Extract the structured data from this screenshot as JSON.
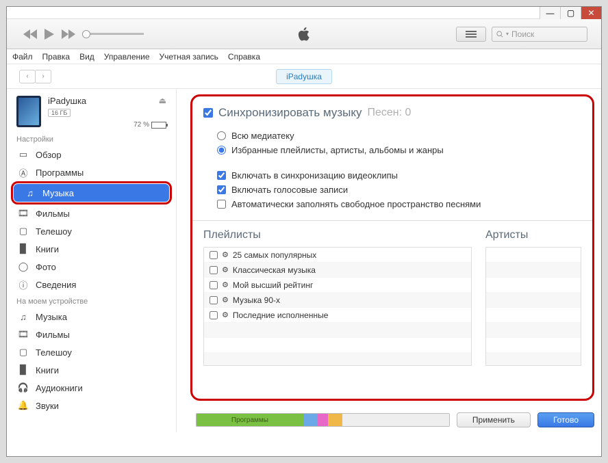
{
  "titlebar": {
    "min": "—",
    "max": "▢",
    "close": "✕"
  },
  "search": {
    "placeholder": "Поиск"
  },
  "menu": {
    "file": "Файл",
    "edit": "Правка",
    "view": "Вид",
    "controls": "Управление",
    "account": "Учетная запись",
    "help": "Справка"
  },
  "device": {
    "pill": "iPadушка",
    "name": "iPadушка",
    "capacity": "16 ГБ",
    "battery": "72 %"
  },
  "sections": {
    "settings": "Настройки",
    "ondevice": "На моем устройстве"
  },
  "settings_items": {
    "overview": "Обзор",
    "apps": "Программы",
    "music": "Музыка",
    "movies": "Фильмы",
    "tv": "Телешоу",
    "books": "Книги",
    "photos": "Фото",
    "info": "Сведения"
  },
  "device_items": {
    "music": "Музыка",
    "movies": "Фильмы",
    "tv": "Телешоу",
    "books": "Книги",
    "audiobooks": "Аудиокниги",
    "sounds": "Звуки"
  },
  "sync": {
    "title": "Синхронизировать музыку",
    "songs": "Песен: 0",
    "all": "Всю медиатеку",
    "selected": "Избранные плейлисты, артисты, альбомы и жанры",
    "videos": "Включать в синхронизацию видеоклипы",
    "voice": "Включать голосовые записи",
    "autofill": "Автоматически заполнять свободное пространство песнями"
  },
  "columns": {
    "playlists": "Плейлисты",
    "artists": "Артисты"
  },
  "playlists": [
    "25 самых популярных",
    "Классическая музыка",
    "Мой высший рейтинг",
    "Музыка 90-х",
    "Последние исполненные"
  ],
  "footer": {
    "apps": "Программы",
    "apply": "Применить",
    "done": "Готово"
  }
}
